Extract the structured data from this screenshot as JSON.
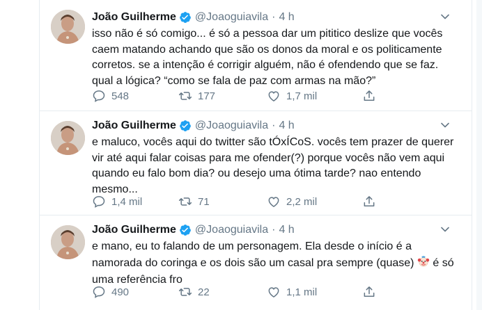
{
  "tweets": [
    {
      "name": "João Guilherme",
      "handle": "@Joaoguiavila",
      "separator": "·",
      "time": "4 h",
      "text": "isso não é só comigo... é só a pessoa dar um pititico deslize que vocês\ncaem matando achando que são os donos da moral e os politicamente\ncorretos. se a intenção é corrigir alguém, não é ofendendo que se faz.\nqual a lógica? “como se fala de paz com armas na mão?”",
      "replies": "548",
      "retweets": "177",
      "likes": "1,7 mil"
    },
    {
      "name": "João Guilherme",
      "handle": "@Joaoguiavila",
      "separator": "·",
      "time": "4 h",
      "text": "e maluco, vocês aqui do twitter são tÓxÍCoS. vocês tem prazer de querer\nvir até aqui falar coisas para me ofender(?) porque vocês não vem aqui\nquando eu falo bom dia? ou desejo uma ótima tarde? nao entendo\nmesmo...",
      "replies": "1,4 mil",
      "retweets": "71",
      "likes": "2,2 mil"
    },
    {
      "name": "João Guilherme",
      "handle": "@Joaoguiavila",
      "separator": "·",
      "time": "4 h",
      "text_before_emoji": "e mano, eu to falando de um personagem. Ela desde o início é a\nnamorada do coringa e os dois são um casal pra sempre (quase) ",
      "emoji": "clown-face",
      "text_after_emoji": " é só\numa referência fro",
      "replies": "490",
      "retweets": "22",
      "likes": "1,1 mil"
    }
  ],
  "colors": {
    "text": "#14171a",
    "secondary": "#657786",
    "verified": "#1da1f2",
    "border": "#e6ecf0"
  }
}
